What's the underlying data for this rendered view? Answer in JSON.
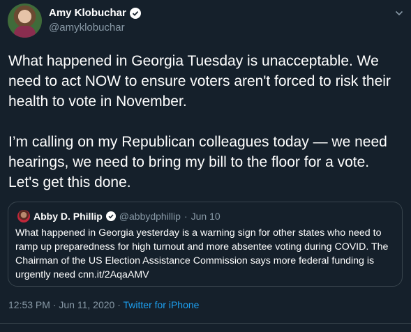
{
  "author": {
    "display_name": "Amy Klobuchar",
    "handle": "@amyklobuchar"
  },
  "tweet_text": "What happened in Georgia Tuesday is unacceptable. We need to act NOW to ensure voters aren't forced to risk their health to vote in November.\n\nI’m calling on my Republican colleagues today — we need hearings, we need to bring my bill to the floor for a vote. Let's get this done.",
  "quoted": {
    "display_name": "Abby D. Phillip",
    "handle": "@abbydphillip",
    "separator": "·",
    "date": "Jun 10",
    "text": "What happened in Georgia yesterday is a warning sign for other states who need to ramp up preparedness for high turnout and more absentee voting during COVID. The Chairman of the US Election Assistance Commission says more federal funding is urgently need cnn.it/2AqaAMV"
  },
  "meta": {
    "time": "12:53 PM",
    "separator1": "·",
    "date": "Jun 11, 2020",
    "separator2": "·",
    "source": "Twitter for iPhone"
  },
  "colors": {
    "background": "#15202b",
    "text_primary": "#ffffff",
    "text_secondary": "#8899a6",
    "accent": "#1da1f2",
    "border": "#38444d"
  },
  "icons": {
    "verified": "verified-badge-icon",
    "more": "chevron-down-icon"
  }
}
